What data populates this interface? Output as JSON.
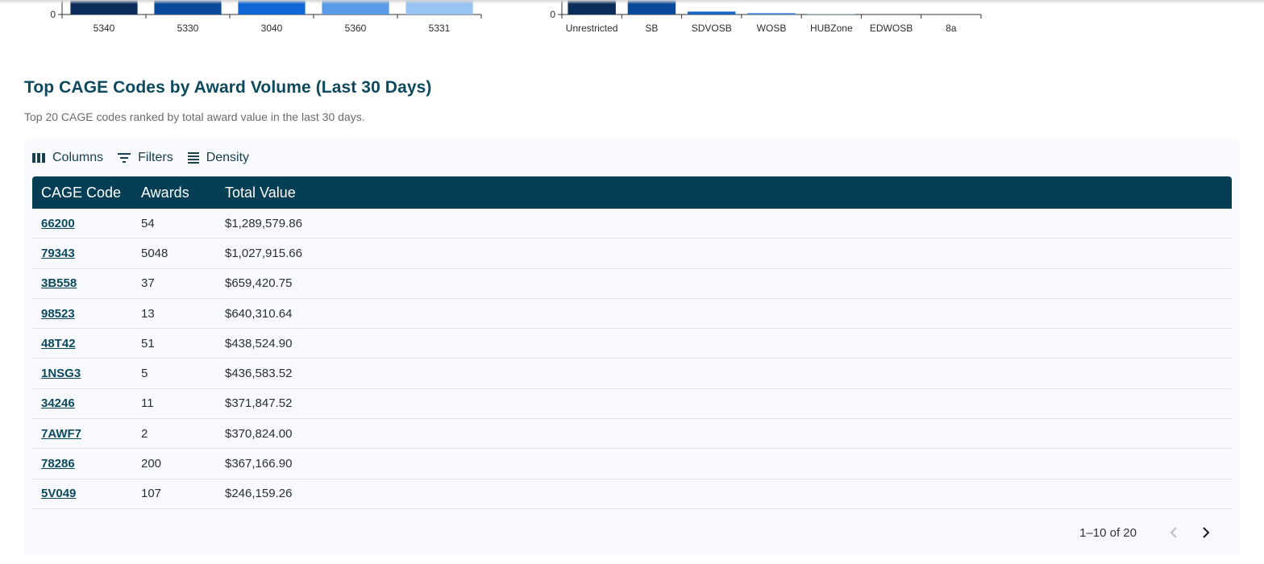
{
  "charts_above": {
    "chart_data": [
      {
        "type": "bar",
        "categories": [
          "5340",
          "5330",
          "3040",
          "5360",
          "5331"
        ],
        "ytick_visible": "0",
        "colors": [
          "#0a2d5a",
          "#0a4a9a",
          "#0f66d4",
          "#5a9ae6",
          "#98c4f4"
        ]
      },
      {
        "type": "bar",
        "categories": [
          "Unrestricted",
          "SB",
          "SDVOSB",
          "WOSB",
          "HUBZone",
          "EDWOSB",
          "8a"
        ],
        "ytick_visible": "0",
        "visible_bar_levels": [
          1.0,
          1.0,
          0.2,
          0.1,
          0.02,
          0,
          0
        ],
        "colors": [
          "#0a2d5a",
          "#0a4a9a",
          "#1a66c8",
          "#4a8ad6",
          "#7aaae0",
          "#a8c8ee",
          "#c8ddf4"
        ]
      }
    ]
  },
  "section": {
    "title": "Top CAGE Codes by Award Volume (Last 30 Days)",
    "subtitle": "Top 20 CAGE codes ranked by total award value in the last 30 days."
  },
  "toolbar": {
    "columns_label": "Columns",
    "filters_label": "Filters",
    "density_label": "Density"
  },
  "table": {
    "headers": [
      "CAGE Code",
      "Awards",
      "Total Value"
    ],
    "rows": [
      {
        "cage": "66200",
        "awards": "54",
        "total": "$1,289,579.86"
      },
      {
        "cage": "79343",
        "awards": "5048",
        "total": "$1,027,915.66"
      },
      {
        "cage": "3B558",
        "awards": "37",
        "total": "$659,420.75"
      },
      {
        "cage": "98523",
        "awards": "13",
        "total": "$640,310.64"
      },
      {
        "cage": "48T42",
        "awards": "51",
        "total": "$438,524.90"
      },
      {
        "cage": "1NSG3",
        "awards": "5",
        "total": "$436,583.52"
      },
      {
        "cage": "34246",
        "awards": "11",
        "total": "$371,847.52"
      },
      {
        "cage": "7AWF7",
        "awards": "2",
        "total": "$370,824.00"
      },
      {
        "cage": "78286",
        "awards": "200",
        "total": "$367,166.90"
      },
      {
        "cage": "5V049",
        "awards": "107",
        "total": "$246,159.26"
      }
    ]
  },
  "pagination": {
    "label": "1–10 of 20"
  },
  "colors": {
    "accent": "#063f55",
    "title": "#0b4a5e",
    "panel_bg": "#f8f9fc"
  }
}
